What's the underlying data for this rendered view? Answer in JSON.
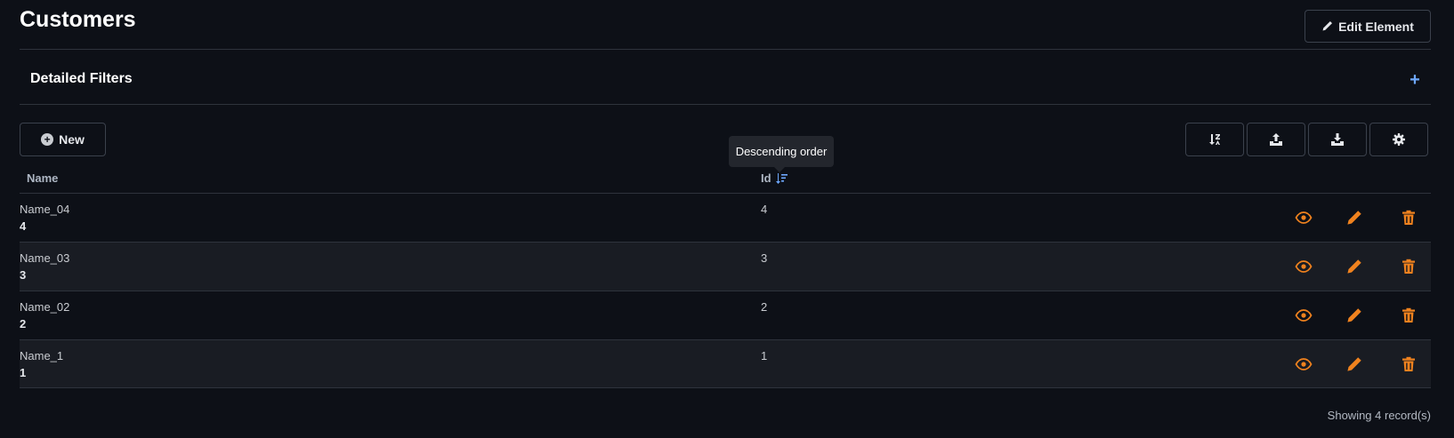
{
  "page": {
    "title": "Customers",
    "edit_label": "Edit Element"
  },
  "filters": {
    "title": "Detailed Filters",
    "toggle": "+"
  },
  "toolbar": {
    "new_label": "New"
  },
  "tooltip": {
    "text": "Descending order"
  },
  "table": {
    "headers": {
      "name": "Name",
      "id": "Id"
    },
    "rows": [
      {
        "name": "Name_04",
        "sub": "4",
        "id": "4"
      },
      {
        "name": "Name_03",
        "sub": "3",
        "id": "3"
      },
      {
        "name": "Name_02",
        "sub": "2",
        "id": "2"
      },
      {
        "name": "Name_1",
        "sub": "1",
        "id": "1"
      }
    ]
  },
  "footer": {
    "record_count": "Showing 4 record(s)"
  },
  "colors": {
    "accent": "#f0821e",
    "link": "#6ea8fe",
    "background": "#0d1017"
  }
}
